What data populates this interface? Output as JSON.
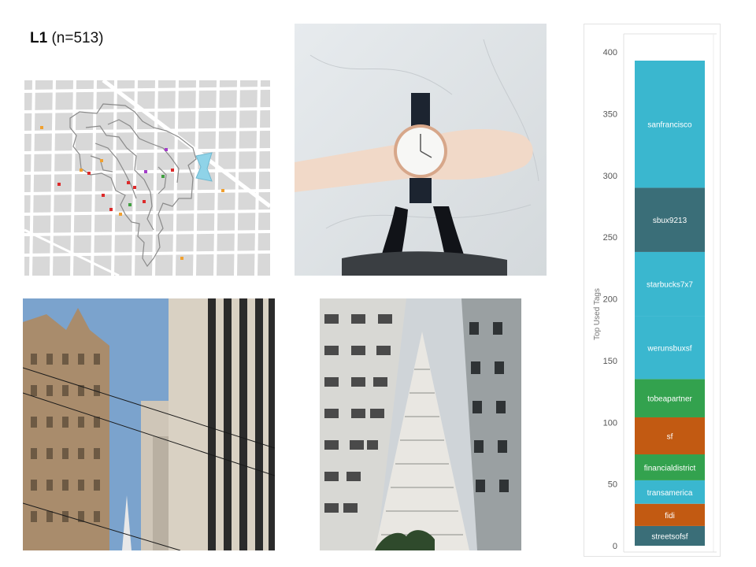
{
  "header": {
    "label": "L1",
    "count": "(n=513)"
  },
  "map": {
    "route_color": "#8a8a8a",
    "highlight_color": "#8fd3e8",
    "marker_colors": {
      "red": "#dd2a2a",
      "orange": "#f0a030",
      "purple": "#a23cc8",
      "green": "#40a040"
    }
  },
  "photos": {
    "watch": "wrist-watch-photo",
    "building": "historic-building-photo",
    "pyramid": "transamerica-pyramid-photo"
  },
  "chart_data": {
    "type": "bar",
    "stacked": true,
    "ylabel": "Top Used Tags",
    "ylim": [
      0,
      420
    ],
    "yticks": [
      0,
      50,
      100,
      150,
      200,
      250,
      300,
      350,
      400
    ],
    "grid": false,
    "segments": [
      {
        "label": "streetsofsf",
        "value": 16,
        "color": "#3a6e78"
      },
      {
        "label": "fidi",
        "value": 18,
        "color": "#c25a12"
      },
      {
        "label": "transamerica",
        "value": 19,
        "color": "#3ab7cf"
      },
      {
        "label": "financialdistrict",
        "value": 21,
        "color": "#33a24e"
      },
      {
        "label": "sf",
        "value": 30,
        "color": "#c25a12"
      },
      {
        "label": "tobeapartner",
        "value": 31,
        "color": "#33a24e"
      },
      {
        "label": "werunsbuxsf",
        "value": 51,
        "color": "#3ab7cf"
      },
      {
        "label": "starbucks7x7",
        "value": 52,
        "color": "#3ab7cf"
      },
      {
        "label": "sbux9213",
        "value": 52,
        "color": "#3a6e78"
      },
      {
        "label": "sanfrancisco",
        "value": 103,
        "color": "#3ab7cf"
      }
    ]
  }
}
